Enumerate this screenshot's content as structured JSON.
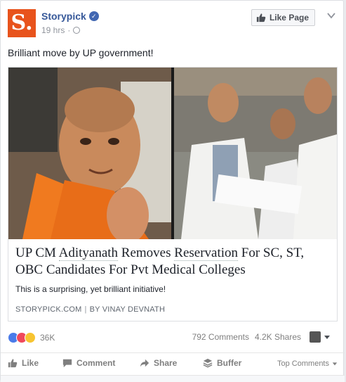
{
  "post": {
    "page_name": "Storypick",
    "avatar_letter": "S.",
    "time": "19 hrs",
    "dot": "·",
    "like_page_label": "Like Page",
    "text": "Brilliant move by UP government!"
  },
  "link": {
    "title_parts": [
      "UP CM ",
      "Adityanath",
      " Removes ",
      "Reservation",
      " For SC, ST, OBC Candidates For Pvt Medical Colleges"
    ],
    "description": "This is a surprising, yet brilliant initiative!",
    "source": "STORYPICK.COM",
    "separator": "|",
    "author": "BY VINAY DEVNATH"
  },
  "stats": {
    "reaction_count": "36K",
    "comments": "792 Comments",
    "shares": "4.2K Shares"
  },
  "actions": {
    "like": "Like",
    "comment": "Comment",
    "share": "Share",
    "buffer": "Buffer",
    "top_comments": "Top Comments"
  },
  "colors": {
    "brand": "#e8531c",
    "link_blue": "#365899",
    "verified": "#4267b2"
  },
  "icons": [
    "verified-icon",
    "globe-icon",
    "thumbs-up-icon",
    "chevron-down-icon",
    "like-reaction-icon",
    "love-reaction-icon",
    "wow-reaction-icon",
    "comment-icon",
    "share-icon",
    "buffer-icon"
  ]
}
